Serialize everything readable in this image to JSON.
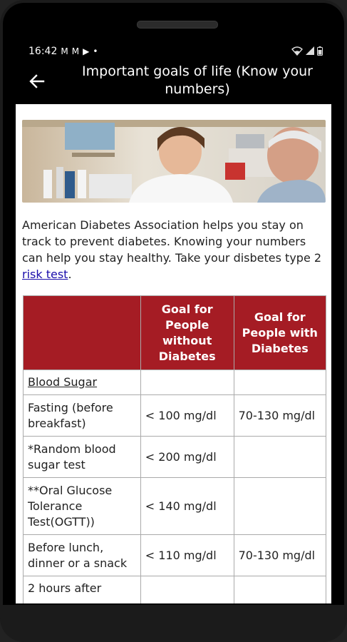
{
  "status": {
    "time": "16:42",
    "left_icons": [
      "M",
      "M",
      "▶",
      "•"
    ],
    "right_icons": [
      "wifi-icon",
      "signal-icon",
      "battery-icon"
    ]
  },
  "appbar": {
    "back_label": "←",
    "title": "Important goals of life (Know your numbers)"
  },
  "intro": {
    "text_before_link": "American Diabetes Association helps you stay on track to prevent diabetes. Knowing your numbers can help you stay healthy. Take your disbetes type 2 ",
    "link_text": "risk test",
    "text_after_link": "."
  },
  "table": {
    "headers": [
      "",
      "Goal for People without Diabetes",
      "Goal for People with Diabetes"
    ],
    "rows": [
      {
        "label": "Blood Sugar",
        "without": "",
        "with": "",
        "underline": true
      },
      {
        "label": "Fasting (before breakfast)",
        "without": "< 100 mg/dl",
        "with": "70-130 mg/dl"
      },
      {
        "label": "*Random blood sugar test",
        "without": "< 200 mg/dl",
        "with": ""
      },
      {
        "label": "**Oral Glucose Tolerance Test(OGTT))",
        "without": "< 140 mg/dl",
        "with": ""
      },
      {
        "label": "Before lunch, dinner or a snack",
        "without": "< 110 mg/dl",
        "with": "70-130 mg/dl"
      },
      {
        "label": "2 hours after",
        "without": "",
        "with": ""
      }
    ]
  },
  "colors": {
    "header_bg": "#a51c24",
    "link": "#1a0dab"
  }
}
